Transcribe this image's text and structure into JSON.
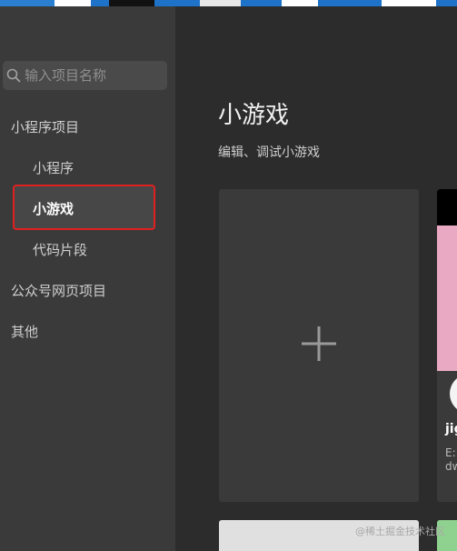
{
  "search": {
    "placeholder": "输入项目名称"
  },
  "sidebar": {
    "group_miniprogram": "小程序项目",
    "item_miniprogram": "小程序",
    "item_minigame": "小游戏",
    "item_snippet": "代码片段",
    "group_official": "公众号网页项目",
    "group_other": "其他"
  },
  "main": {
    "title": "小游戏",
    "subtitle": "编辑、调试小游戏",
    "add_symbol": "+"
  },
  "project_card": {
    "name": "jig",
    "path_line1": "E:",
    "path_line2": "dw"
  },
  "watermark": "@稀土掘金技术社区",
  "colors": {
    "highlight_border": "#e02020",
    "sidebar_bg": "#3a3a3a",
    "main_bg": "#2c2c2c",
    "thumb_pink": "#e9a9c3"
  }
}
